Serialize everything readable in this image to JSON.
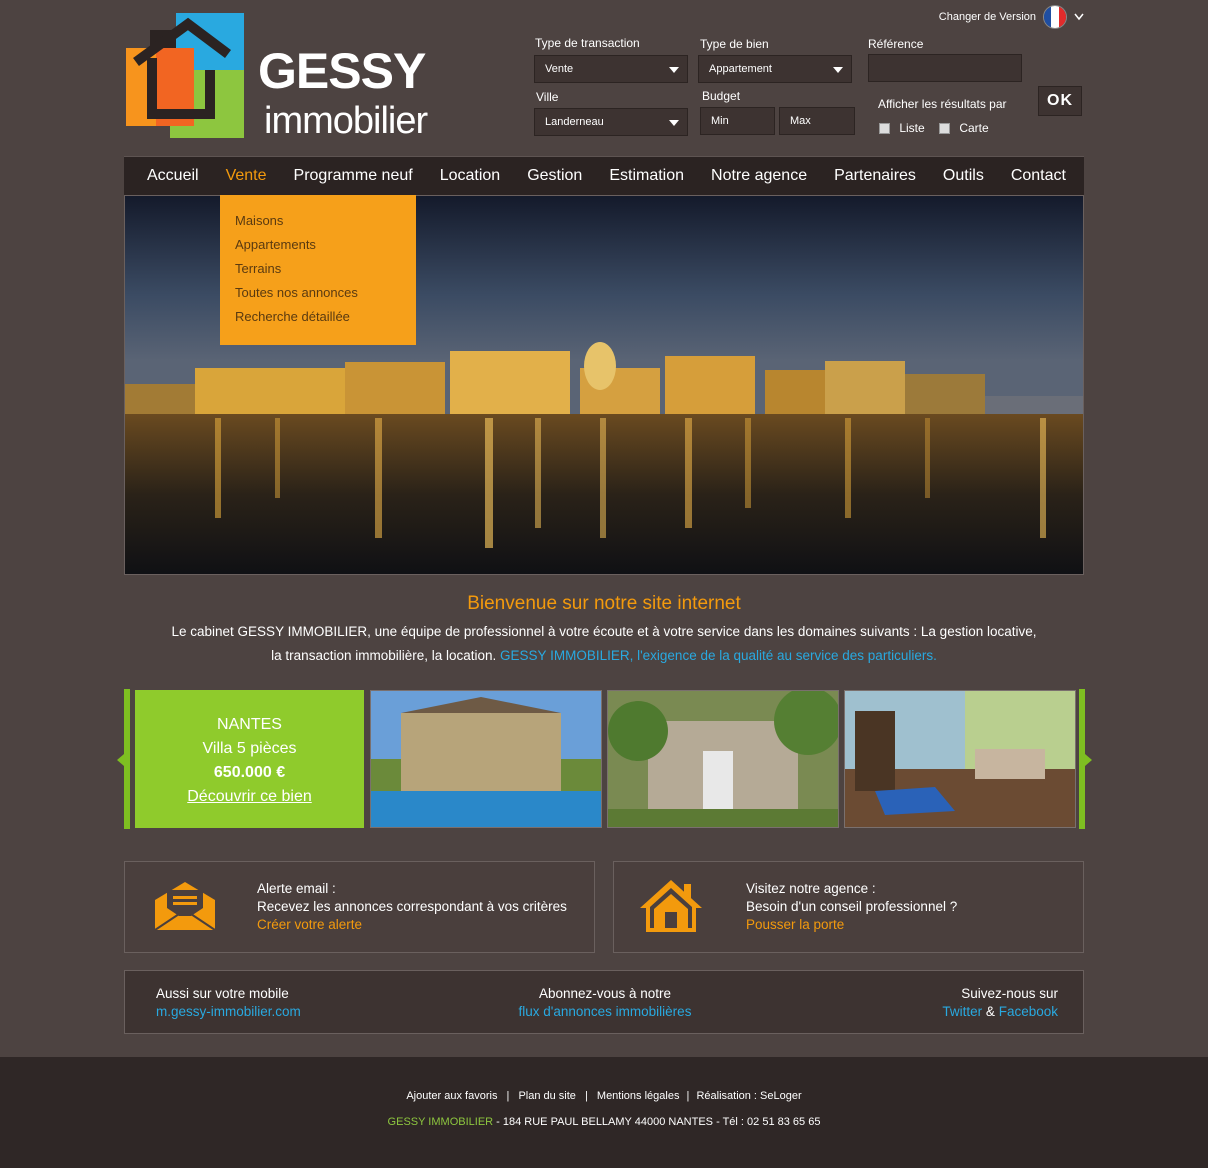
{
  "logo": {
    "line1": "GESSY",
    "line2": "immobilier"
  },
  "version": {
    "label": "Changer de Version"
  },
  "search": {
    "transaction_label": "Type de transaction",
    "transaction_value": "Vente",
    "bien_label": "Type de bien",
    "bien_value": "Appartement",
    "reference_label": "Référence",
    "reference_value": "",
    "ville_label": "Ville",
    "ville_value": "Landerneau",
    "budget_label": "Budget",
    "budget_min": "Min",
    "budget_max": "Max",
    "afficher_label": "Afficher les résultats par",
    "liste_label": "Liste",
    "carte_label": "Carte",
    "ok_label": "OK"
  },
  "nav": {
    "items": [
      "Accueil",
      "Vente",
      "Programme neuf",
      "Location",
      "Gestion",
      "Estimation",
      "Notre agence",
      "Partenaires",
      "Outils",
      "Contact"
    ]
  },
  "dropdown": {
    "items": [
      "Maisons",
      "Appartements",
      "Terrains",
      "Toutes nos annonces",
      "Recherche détaillée"
    ]
  },
  "welcome": {
    "title": "Bienvenue sur notre site internet",
    "text1": "Le cabinet GESSY IMMOBILIER, une équipe de professionnel à votre écoute et à votre service dans les domaines suivants : La gestion locative,",
    "text2": "la transaction immobilière, la location.",
    "text2_link": "GESSY IMMOBILIER, l'exigence de la qualité au service des particuliers."
  },
  "featured": {
    "city": "NANTES",
    "type": "Villa 5 pièces",
    "price": "650.000 €",
    "link": "Découvrir ce bien"
  },
  "alert_box": {
    "title": "Alerte email :",
    "line2": "Recevez les annonces correspondant à vos critères",
    "link": "Créer votre alerte"
  },
  "agency_box": {
    "title": "Visitez notre agence :",
    "line2": "Besoin d'un conseil professionnel ?",
    "link": "Pousser la porte"
  },
  "bottom": {
    "mobile_label": "Aussi sur votre mobile",
    "mobile_link": "m.gessy-immobilier.com",
    "rss_label": "Abonnez-vous à notre",
    "rss_link": "flux d'annonces immobilières",
    "social_label": "Suivez-nous sur",
    "twitter": "Twitter",
    "amp": "&",
    "facebook": "Facebook"
  },
  "footer": {
    "links": [
      "Ajouter aux favoris",
      "Plan du site",
      "Mentions légales",
      "Réalisation : SeLoger"
    ],
    "sep": "|",
    "company": "GESSY IMMOBILIER",
    "address": " - 184 RUE PAUL BELLAMY 44000 NANTES - Tél : 02 51 83 65 65"
  },
  "colors": {
    "accent": "#f39a0d",
    "green": "#8dc63f",
    "link_blue": "#29a9e0",
    "bg": "#4d4341"
  }
}
